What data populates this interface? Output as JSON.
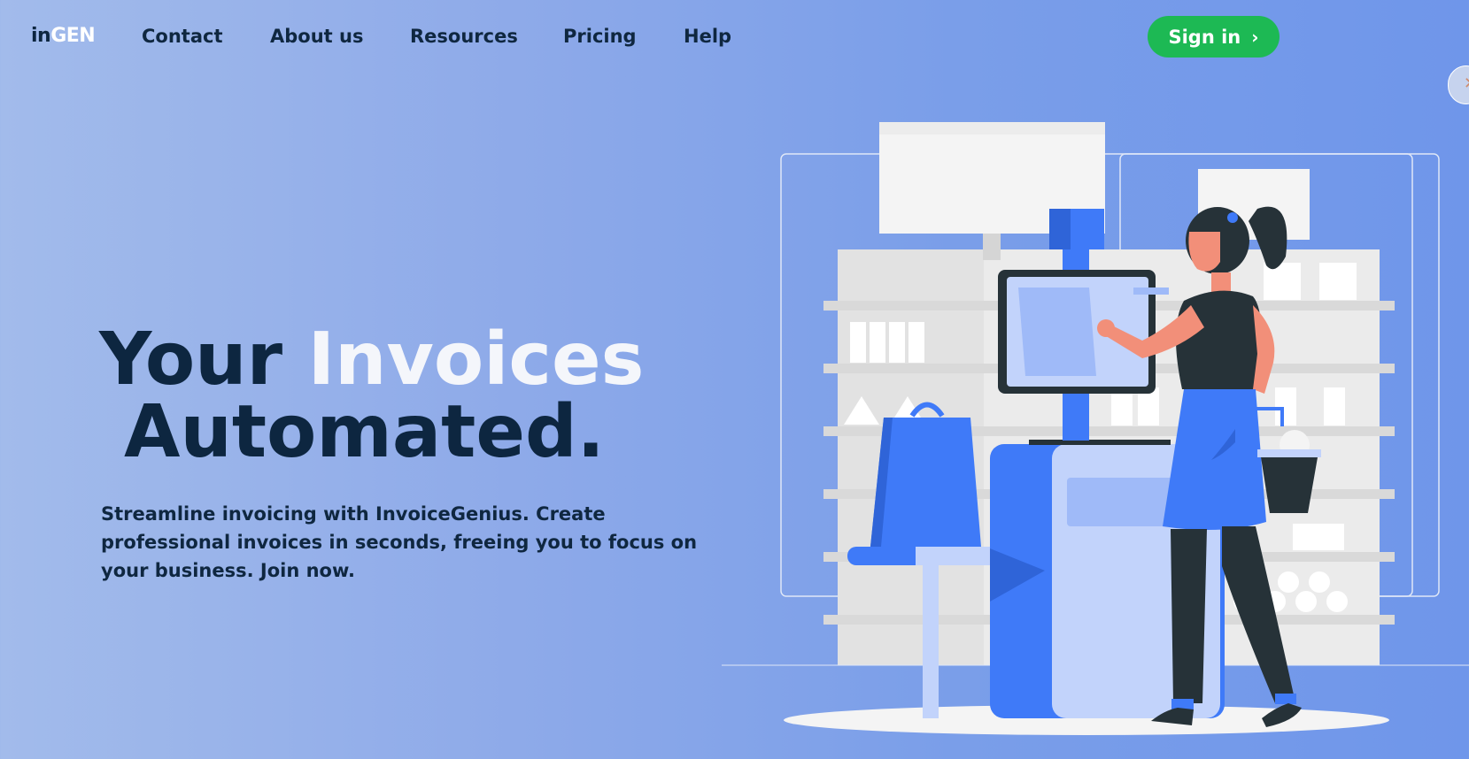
{
  "nav": {
    "logo_in": "in",
    "logo_gen": "GEN",
    "links": [
      "Contact",
      "About us",
      "Resources",
      "Pricing",
      "Help"
    ],
    "signin_label": "Sign in",
    "signin_icon": "chevron-right-icon",
    "signin_chevron": "›"
  },
  "side_widget": {
    "icon": "close-icon",
    "glyph": "✕"
  },
  "hero": {
    "title_part1": "Your ",
    "title_highlight": "Invoices",
    "title_line2": "Automated.",
    "description": "Streamline invoicing with InvoiceGenius. Create professional invoices in seconds, freeing you to focus on your business. Join now."
  },
  "colors": {
    "accent_green": "#1db954",
    "navy_text": "#0d2640",
    "illustration_blue": "#3f7af8"
  }
}
